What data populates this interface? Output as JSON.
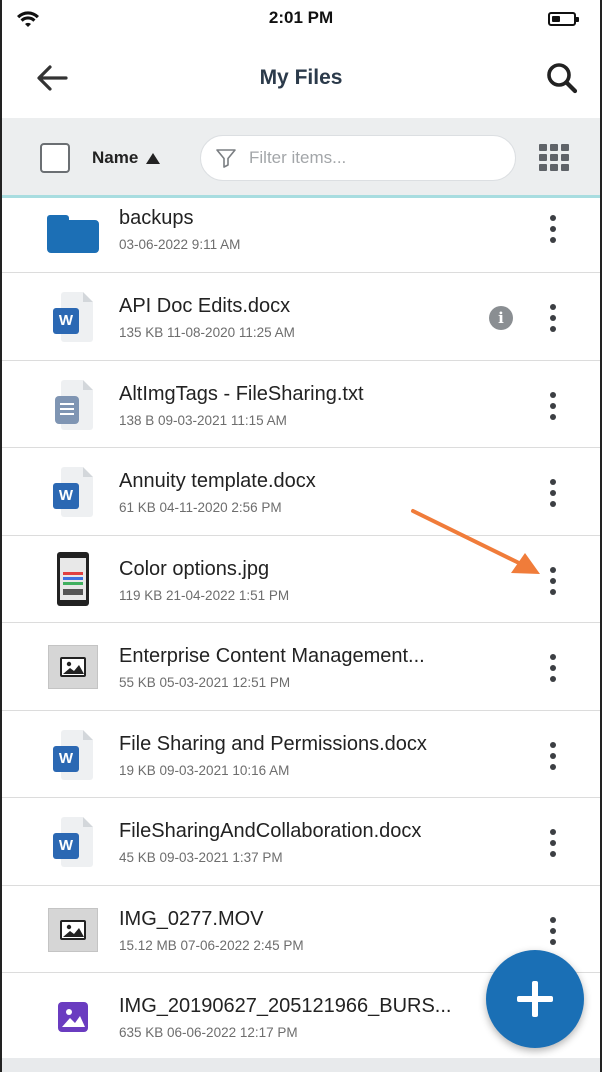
{
  "status_bar": {
    "time": "2:01 PM",
    "battery_level": 0.4
  },
  "header": {
    "title": "My Files",
    "back_icon": "arrow-left-icon",
    "search_icon": "search-icon"
  },
  "toolbar": {
    "sort_label": "Name",
    "sort_direction": "ascending",
    "filter_placeholder": "Filter items...",
    "view_icon": "grid-view-icon"
  },
  "files": [
    {
      "name": "backups",
      "meta": "03-06-2022 9:11 AM",
      "type": "folder"
    },
    {
      "name": "API Doc Edits.docx",
      "meta": "135 KB 11-08-2020 11:25 AM",
      "type": "word",
      "badge": "W",
      "info": "i"
    },
    {
      "name": "AltImgTags - FileSharing.txt",
      "meta": "138 B 09-03-2021 11:15 AM",
      "type": "text"
    },
    {
      "name": "Annuity template.docx",
      "meta": "61 KB 04-11-2020 2:56 PM",
      "type": "word",
      "badge": "W"
    },
    {
      "name": "Color options.jpg",
      "meta": "119 KB 21-04-2022 1:51 PM",
      "type": "phone-image"
    },
    {
      "name": "Enterprise Content Management...",
      "meta": "55 KB 05-03-2021 12:51 PM",
      "type": "image"
    },
    {
      "name": "File Sharing and Permissions.docx",
      "meta": "19 KB 09-03-2021 10:16 AM",
      "type": "word",
      "badge": "W"
    },
    {
      "name": "FileSharingAndCollaboration.docx",
      "meta": "45 KB 09-03-2021 1:37 PM",
      "type": "word",
      "badge": "W"
    },
    {
      "name": "IMG_0277.MOV",
      "meta": "15.12 MB 07-06-2022 2:45 PM",
      "type": "image"
    },
    {
      "name": "IMG_20190627_205121966_BURS...",
      "meta": "635 KB 06-06-2022 12:17 PM",
      "type": "purple-image"
    }
  ],
  "fab": {
    "icon": "plus-icon"
  },
  "colors": {
    "accent": "#1a6fb5",
    "word": "#2b68b3",
    "annotation_arrow": "#f07c3a",
    "toolbar_bg": "#eceeef",
    "toolbar_border": "#a8dde0"
  }
}
